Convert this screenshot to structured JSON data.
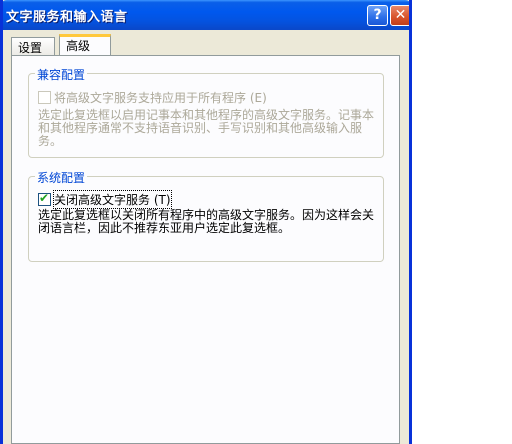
{
  "window": {
    "title": "文字服务和输入语言",
    "help_label": "?",
    "close_label": "✕"
  },
  "tabs": [
    {
      "label": "设置",
      "selected": false
    },
    {
      "label": "高级",
      "selected": true
    }
  ],
  "compat_group": {
    "title": "兼容配置",
    "checkbox_label": "将高级文字服务支持应用于所有程序 (E)",
    "checked": false,
    "enabled": false,
    "description": "选定此复选框以启用记事本和其他程序的高级文字服务。记事本和其他程序通常不支持语音识别、手写识别和其他高级输入服务。"
  },
  "system_group": {
    "title": "系统配置",
    "checkbox_label": "关闭高级文字服务 (T)",
    "checked": true,
    "enabled": true,
    "description": "选定此复选框以关闭所有程序中的高级文字服务。因为这样会关闭语言栏，因此不推荐东亚用户选定此复选框。"
  },
  "icons": {
    "check": "✔"
  }
}
